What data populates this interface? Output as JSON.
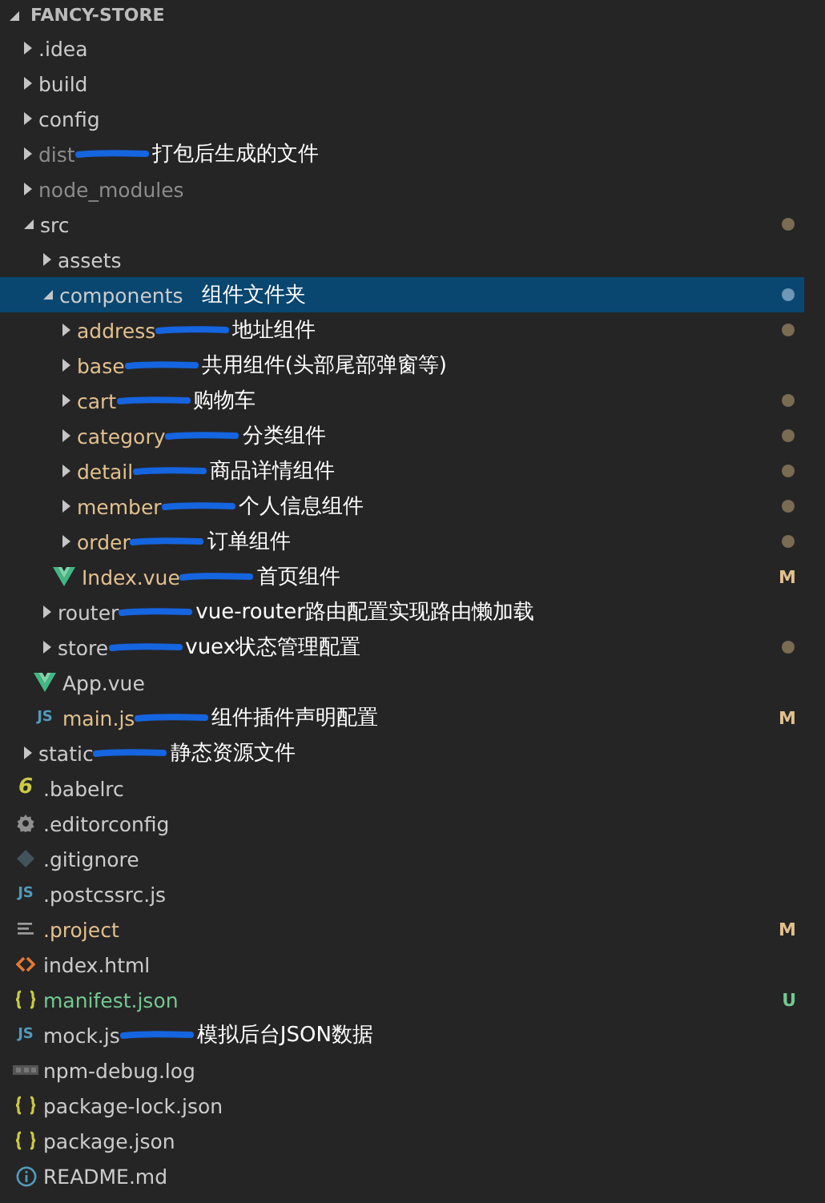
{
  "explorer": {
    "title": "FANCY-STORE",
    "expanded": true
  },
  "tree": [
    {
      "kind": "folder",
      "name": ".idea",
      "expanded": false
    },
    {
      "kind": "folder",
      "name": "build",
      "expanded": false
    },
    {
      "kind": "folder",
      "name": "config",
      "expanded": false
    },
    {
      "kind": "folder",
      "name": "dist",
      "expanded": false,
      "color": "#8c8c8c",
      "scribble": true,
      "note": "打包后生成的文件"
    },
    {
      "kind": "folder",
      "name": "node_modules",
      "expanded": false,
      "color": "#8c8c8c"
    },
    {
      "kind": "folder",
      "name": "src",
      "expanded": true,
      "dot": true,
      "children": [
        {
          "kind": "folder",
          "name": "assets",
          "expanded": false
        },
        {
          "kind": "folder",
          "name": "components",
          "expanded": true,
          "selected": true,
          "dot": true,
          "note": "组件文件夹",
          "children": [
            {
              "kind": "folder",
              "name": "address",
              "expanded": false,
              "color": "#e2c08d",
              "dot": true,
              "scribble": true,
              "note": "地址组件"
            },
            {
              "kind": "folder",
              "name": "base",
              "expanded": false,
              "color": "#e2c08d",
              "scribble": true,
              "note": "共用组件(头部尾部弹窗等)"
            },
            {
              "kind": "folder",
              "name": "cart",
              "expanded": false,
              "color": "#e2c08d",
              "dot": true,
              "scribble": true,
              "note": "购物车"
            },
            {
              "kind": "folder",
              "name": "category",
              "expanded": false,
              "color": "#e2c08d",
              "dot": true,
              "scribble": true,
              "note": "分类组件"
            },
            {
              "kind": "folder",
              "name": "detail",
              "expanded": false,
              "color": "#e2c08d",
              "dot": true,
              "scribble": true,
              "note": "商品详情组件"
            },
            {
              "kind": "folder",
              "name": "member",
              "expanded": false,
              "color": "#e2c08d",
              "dot": true,
              "scribble": true,
              "note": "个人信息组件"
            },
            {
              "kind": "folder",
              "name": "order",
              "expanded": false,
              "color": "#e2c08d",
              "dot": true,
              "scribble": true,
              "note": "订单组件"
            },
            {
              "kind": "vue",
              "name": "Index.vue",
              "color": "#e2c08d",
              "badge": "M",
              "scribble": true,
              "note": "首页组件"
            }
          ]
        },
        {
          "kind": "folder",
          "name": "router",
          "expanded": false,
          "scribble": true,
          "note": "vue-router路由配置实现路由懒加载"
        },
        {
          "kind": "folder",
          "name": "store",
          "expanded": false,
          "dot": true,
          "scribble": true,
          "note": "vuex状态管理配置"
        },
        {
          "kind": "vue",
          "name": "App.vue"
        },
        {
          "kind": "js",
          "glyph": "JS",
          "name": "main.js",
          "color": "#e2c08d",
          "badge": "M",
          "scribble": true,
          "note": "组件插件声明配置"
        }
      ]
    },
    {
      "kind": "folder",
      "name": "static",
      "expanded": false,
      "scribble": true,
      "note": "静态资源文件"
    },
    {
      "kind": "babel",
      "glyph": "6",
      "name": ".babelrc"
    },
    {
      "kind": "gear",
      "name": ".editorconfig"
    },
    {
      "kind": "git",
      "name": ".gitignore"
    },
    {
      "kind": "js",
      "glyph": "JS",
      "name": ".postcssrc.js"
    },
    {
      "kind": "lines",
      "name": ".project",
      "color": "#e2c08d",
      "badge": "M"
    },
    {
      "kind": "html",
      "name": "index.html"
    },
    {
      "kind": "json",
      "name": "manifest.json",
      "color": "#73c991",
      "badge": "U"
    },
    {
      "kind": "js",
      "glyph": "JS",
      "name": "mock.js",
      "scribble": true,
      "note": "模拟后台JSON数据"
    },
    {
      "kind": "npm",
      "name": "npm-debug.log"
    },
    {
      "kind": "json",
      "name": "package-lock.json"
    },
    {
      "kind": "json",
      "name": "package.json"
    },
    {
      "kind": "info",
      "name": "README.md"
    }
  ]
}
